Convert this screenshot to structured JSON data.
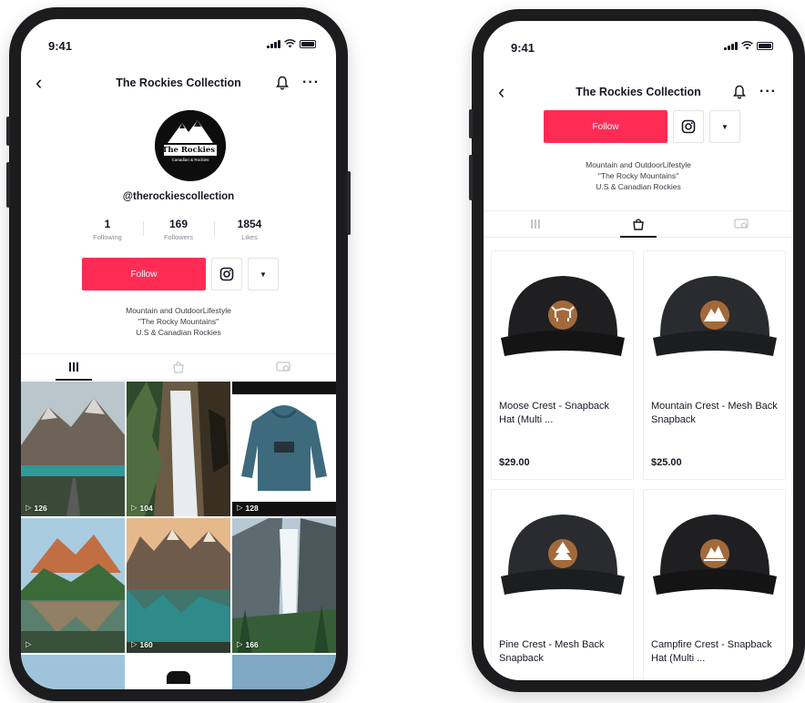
{
  "status": {
    "time": "9:41"
  },
  "profile": {
    "title": "The Rockies Collection",
    "logo_text": {
      "line1": "The Rockies Collection",
      "line2": "Canadian & Rockies"
    },
    "handle": "@therockiescollection",
    "stats": [
      {
        "value": "1",
        "label": "Following"
      },
      {
        "value": "169",
        "label": "Followers"
      },
      {
        "value": "1854",
        "label": "Likes"
      }
    ],
    "follow_label": "Follow",
    "bio": [
      "Mountain and OutdoorLifestyle",
      "\"The Rocky Mountains\"",
      "U.S & Canadian Rockies"
    ],
    "tabs": [
      {
        "icon": "grid-icon",
        "active": true
      },
      {
        "icon": "shopping-bag-icon",
        "active": false
      },
      {
        "icon": "tagged-icon",
        "active": false
      }
    ]
  },
  "videos": [
    {
      "views": "126",
      "scene": "mountain-lake-road"
    },
    {
      "views": "104",
      "scene": "waterfall-forest"
    },
    {
      "views": "128",
      "scene": "hoodie"
    },
    {
      "views": "",
      "scene": "maroon-bells"
    },
    {
      "views": "160",
      "scene": "moraine-lake"
    },
    {
      "views": "166",
      "scene": "waterfall-cliff"
    }
  ],
  "shop": {
    "title": "The Rockies Collection",
    "follow_label": "Follow",
    "bio": [
      "Mountain and OutdoorLifestyle",
      "\"The Rocky Mountains\"",
      "U.S & Canadian Rockies"
    ],
    "products": [
      {
        "name": "Moose Crest - Snapback Hat (Multi ...",
        "price": "$29.00",
        "emblem": "moose-icon",
        "hat_color": "#1f1f21"
      },
      {
        "name": "Mountain Crest - Mesh Back Snapback",
        "price": "$25.00",
        "emblem": "mountain-icon",
        "hat_color": "#2a2b2e"
      },
      {
        "name": "Pine Crest - Mesh Back Snapback",
        "price": "",
        "emblem": "pine-tree-icon",
        "hat_color": "#2a2b2e"
      },
      {
        "name": "Campfire Crest - Snapback Hat (Multi ...",
        "price": "",
        "emblem": "campfire-icon",
        "hat_color": "#1f1f21"
      }
    ]
  },
  "colors": {
    "accent": "#fe2c55",
    "text": "#161823",
    "muted": "#8a8b91",
    "patch": "#a26a3a"
  }
}
